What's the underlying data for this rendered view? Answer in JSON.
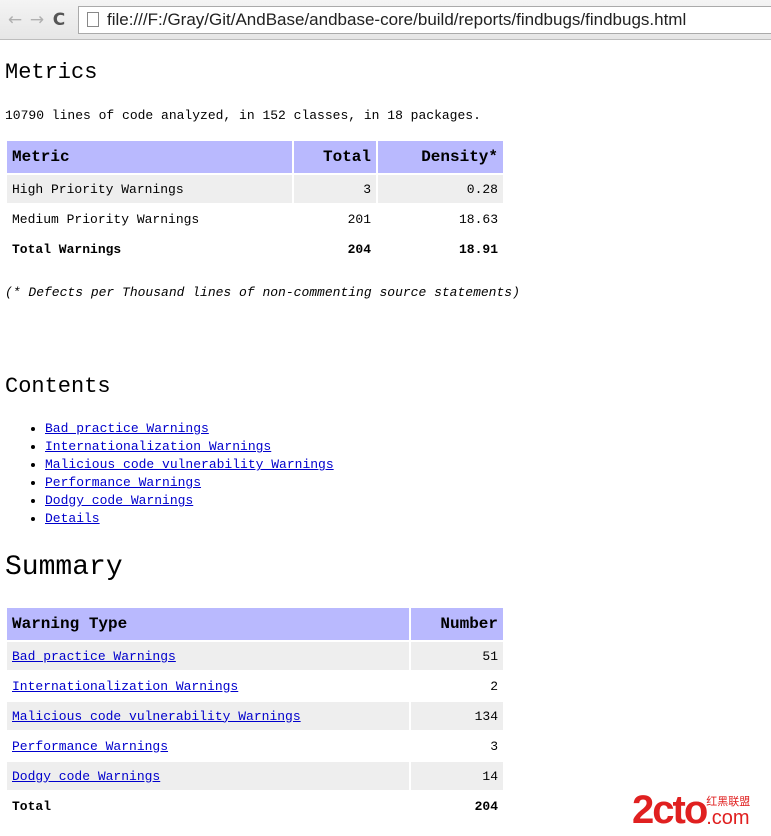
{
  "browser": {
    "url": "file:///F:/Gray/Git/AndBase/andbase-core/build/reports/findbugs/findbugs.html"
  },
  "metrics": {
    "title": "Metrics",
    "summary": "10790 lines of code analyzed, in 152 classes, in 18 packages.",
    "headers": [
      "Metric",
      "Total",
      "Density*"
    ],
    "rows": [
      [
        "High Priority Warnings",
        "3",
        "0.28"
      ],
      [
        "Medium Priority Warnings",
        "201",
        "18.63"
      ],
      [
        "Total Warnings",
        "204",
        "18.91"
      ]
    ],
    "footnote": "(* Defects per Thousand lines of non-commenting source statements)"
  },
  "contents": {
    "title": "Contents",
    "items": [
      "Bad practice Warnings",
      "Internationalization Warnings",
      "Malicious code vulnerability Warnings",
      "Performance Warnings",
      "Dodgy code Warnings",
      "Details"
    ]
  },
  "summary": {
    "title": "Summary",
    "headers": [
      "Warning Type",
      "Number"
    ],
    "rows": [
      [
        "Bad practice Warnings",
        "51"
      ],
      [
        "Internationalization Warnings",
        "2"
      ],
      [
        "Malicious code vulnerability Warnings",
        "134"
      ],
      [
        "Performance Warnings",
        "3"
      ],
      [
        "Dodgy code Warnings",
        "14"
      ]
    ],
    "total": [
      "Total",
      "204"
    ]
  },
  "watermark": {
    "logo": "2cto",
    "cn": "红黑联盟",
    "com": ".com"
  }
}
